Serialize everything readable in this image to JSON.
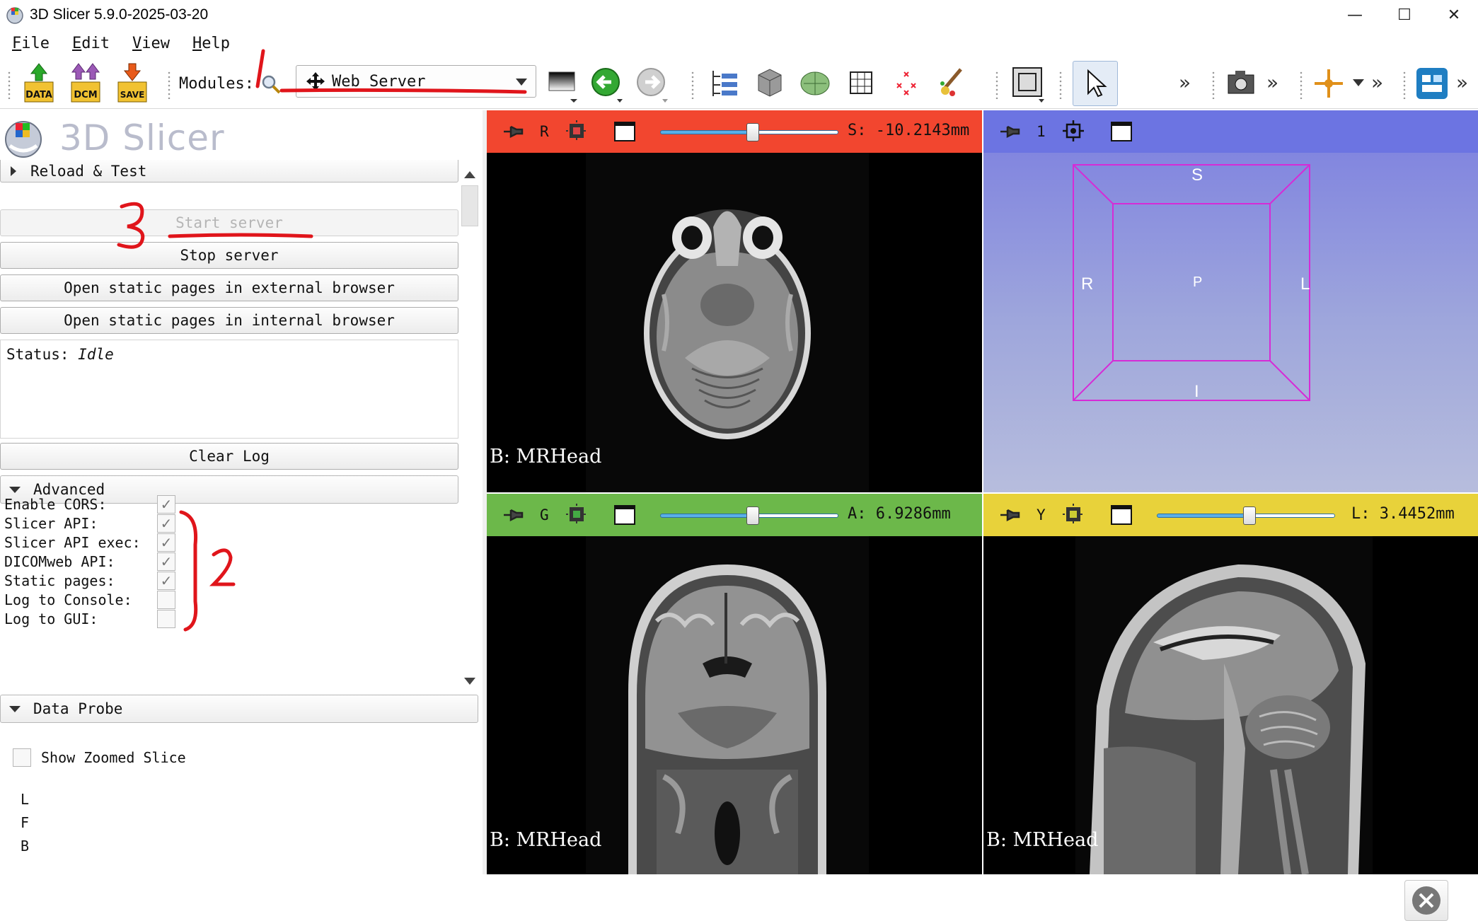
{
  "window": {
    "title": "3D Slicer 5.9.0-2025-03-20",
    "minimize": "—",
    "maximize": "☐",
    "close": "✕"
  },
  "menu": {
    "items": [
      {
        "label": "File",
        "mnemonic": "F",
        "rest": "ile"
      },
      {
        "label": "Edit",
        "mnemonic": "E",
        "rest": "dit"
      },
      {
        "label": "View",
        "mnemonic": "V",
        "rest": "iew"
      },
      {
        "label": "Help",
        "mnemonic": "H",
        "rest": "elp"
      }
    ]
  },
  "toolbar": {
    "data_label": "DATA",
    "dcm_label": "DCM",
    "save_label": "SAVE",
    "modules_label": "Modules:",
    "module_selected": "Web Server",
    "overflow": "»"
  },
  "panel": {
    "logo_text": "3D Slicer",
    "reload_test": "Reload & Test",
    "start_server": "Start server",
    "stop_server": "Stop server",
    "open_external": "Open static pages in external browser",
    "open_internal": "Open static pages in internal browser",
    "status_label": "Status:",
    "status_value": "Idle",
    "clear_log": "Clear Log",
    "advanced": "Advanced",
    "options": [
      {
        "label": "Enable CORS:",
        "checked": true
      },
      {
        "label": "Slicer API:",
        "checked": true
      },
      {
        "label": "Slicer API exec:",
        "checked": true
      },
      {
        "label": "DICOMweb API:",
        "checked": true
      },
      {
        "label": "Static pages:",
        "checked": true
      },
      {
        "label": "Log to Console:",
        "checked": false
      },
      {
        "label": "Log to GUI:",
        "checked": false
      }
    ],
    "data_probe": "Data Probe",
    "show_zoomed_slice": "Show Zoomed Slice",
    "coords": [
      "L",
      "F",
      "B"
    ]
  },
  "views": {
    "red": {
      "label": "R",
      "offset": "S: -10.2143mm",
      "caption": "B: MRHead",
      "color": "#f2462f",
      "slider_pos": 0.52
    },
    "threed": {
      "label": "1",
      "color": "#6c74e2",
      "axes": {
        "top": "S",
        "left": "R",
        "center": "P",
        "right": "L",
        "bottom": "I"
      }
    },
    "green": {
      "label": "G",
      "offset": "A: 6.9286mm",
      "caption": "B: MRHead",
      "color": "#6cb84a",
      "slider_pos": 0.52
    },
    "yellow": {
      "label": "Y",
      "offset": "L: 3.4452mm",
      "caption": "B: MRHead",
      "color": "#e8d23a",
      "slider_pos": 0.52
    }
  },
  "annotations": {
    "one": "1",
    "two": "2",
    "three": "3"
  },
  "colors": {
    "red_view": "#f2462f",
    "green_view": "#6cb84a",
    "yellow_view": "#e8d23a",
    "threed_bg": "#7b7ee0",
    "annotation": "#e0151b",
    "bounding_box": "#d62bd6"
  }
}
